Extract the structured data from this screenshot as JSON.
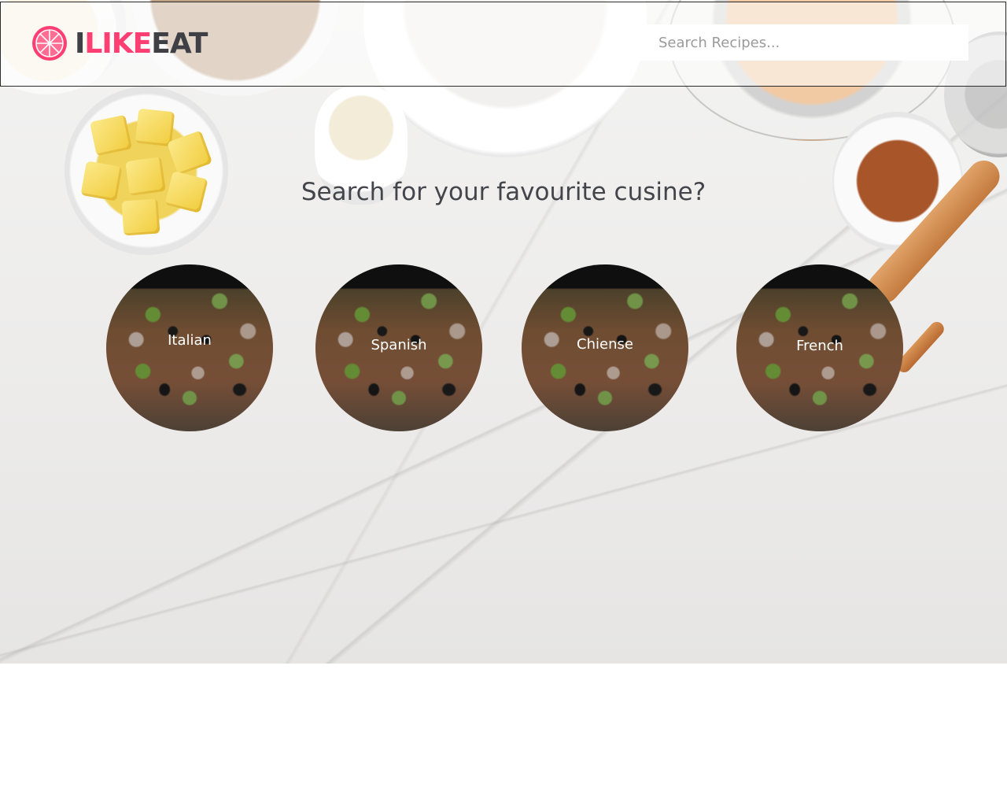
{
  "brand": {
    "part1": "I",
    "part2": "LIKE",
    "part3": "EAT",
    "icon": "citrus-slice-icon",
    "accent_color": "#ff3f73",
    "dark_color": "#3f4046"
  },
  "search": {
    "placeholder": "Search Recipes...",
    "value": ""
  },
  "main": {
    "headline": "Search for your favourite cusine?",
    "cuisines": [
      {
        "label": "Italian"
      },
      {
        "label": "Spanish"
      },
      {
        "label": "Chiense"
      },
      {
        "label": "French"
      }
    ]
  }
}
